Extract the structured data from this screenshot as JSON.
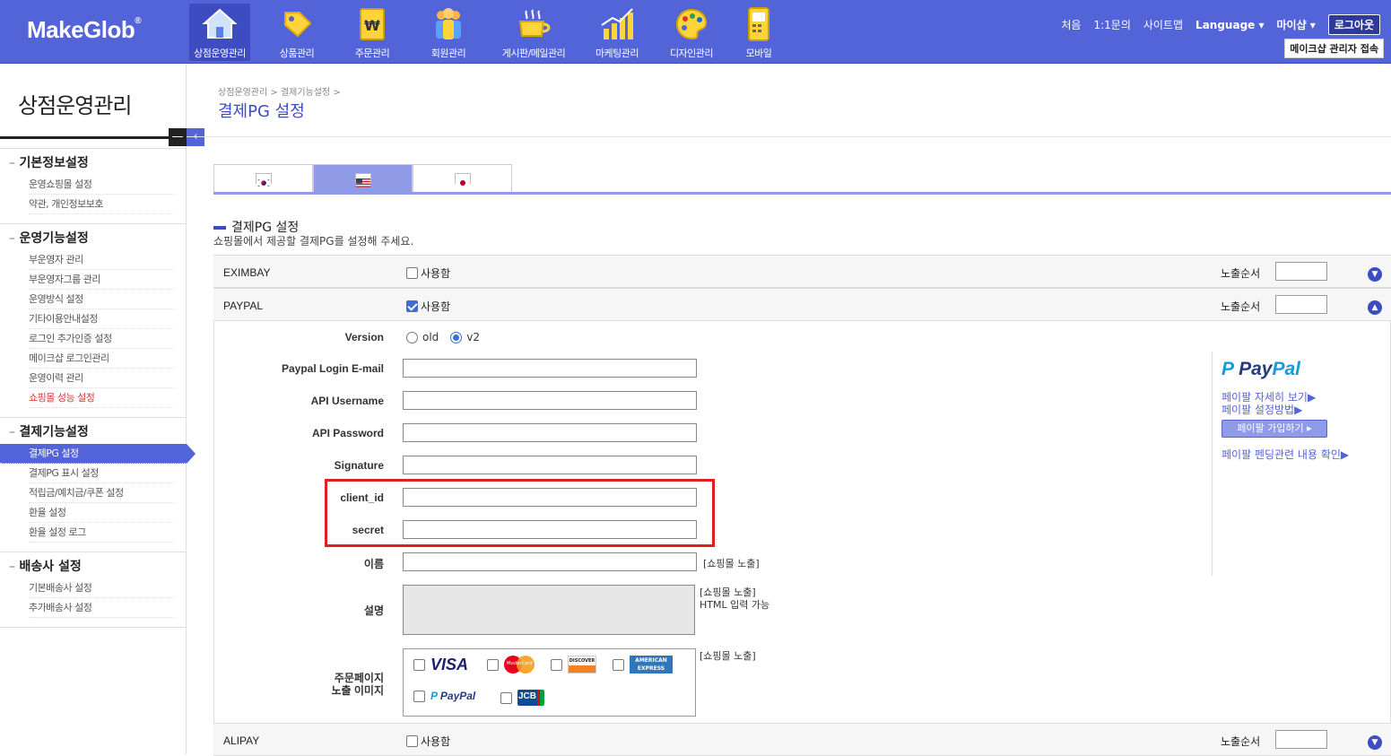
{
  "header": {
    "logo": "MakeGlob",
    "logo_mark": "®",
    "nav": [
      {
        "label": "상점운영관리",
        "icon": "home-icon"
      },
      {
        "label": "상품관리",
        "icon": "tag-icon"
      },
      {
        "label": "주문관리",
        "icon": "won-order-icon"
      },
      {
        "label": "회원관리",
        "icon": "members-icon"
      },
      {
        "label": "게시판/메일관리",
        "icon": "coffee-cup-icon"
      },
      {
        "label": "마케팅관리",
        "icon": "bar-chart-icon"
      },
      {
        "label": "디자인관리",
        "icon": "palette-icon"
      },
      {
        "label": "모바일",
        "icon": "mobile-icon"
      }
    ],
    "links": [
      "처음",
      "1:1문의",
      "사이트맵",
      "Language ▾",
      "마이샵 ▾"
    ],
    "logout": "로그아웃",
    "admin": "메이크샵 관리자 접속"
  },
  "sidebar": {
    "title": "상점운영관리",
    "groups": [
      {
        "header": "기본정보설정",
        "items": [
          "운영쇼핑몰 설정",
          "약관, 개인정보보호"
        ]
      },
      {
        "header": "운영기능설정",
        "items": [
          "부운영자 관리",
          "부운영자그룹 관리",
          "운영방식 설정",
          "기타이용안내설정",
          "로그인 추가인증 설정",
          "메이크샵 로그인관리",
          "운영이력 관리",
          "쇼핑몰 성능 설정"
        ]
      },
      {
        "header": "결제기능설정",
        "items": [
          "결제PG 설정",
          "결제PG 표시 설정",
          "적립금/예치금/쿠폰 설정",
          "환율 설정",
          "환율 설정 로그"
        ]
      },
      {
        "header": "배송사 설정",
        "items": [
          "기본배송사 설정",
          "추가배송사 설정"
        ]
      }
    ]
  },
  "main": {
    "breadcrumb": "상점운영관리 > 결제기능설정 >",
    "title": "결제PG 설정",
    "tabs": [
      "korea-flag-icon",
      "usa-flag-icon",
      "japan-flag-icon"
    ],
    "section_title": "결제PG 설정",
    "section_desc": "쇼핑몰에서 제공할 결제PG를 설정해 주세요.",
    "use_label": "사용함",
    "order_label": "노출순서",
    "pg_rows": [
      {
        "name": "EXIMBAY",
        "checked": false
      },
      {
        "name": "PAYPAL",
        "checked": true
      },
      {
        "name": "ALIPAY",
        "checked": false
      }
    ],
    "paypal": {
      "version_label": "Version",
      "version_options": [
        "old",
        "v2"
      ],
      "version_selected": "v2",
      "fields": [
        "Paypal Login E-mail",
        "API Username",
        "API Password",
        "Signature",
        "client_id",
        "secret",
        "이름"
      ],
      "name_note": "[쇼핑몰 노출]",
      "desc_label": "설명",
      "desc_note1": "[쇼핑몰 노출]",
      "desc_note2": "HTML 입력 가능",
      "img_label1": "주문페이지",
      "img_label2": "노출 이미지",
      "img_note": "[쇼핑몰 노출]",
      "cards": [
        "VISA",
        "MasterCard",
        "DISCOVER",
        "AMERICAN EXPRESS",
        "PayPal",
        "JCB"
      ]
    },
    "paypal_panel": {
      "logo_a": "Pay",
      "logo_b": "Pal",
      "link1": "페이팔 자세히 보기▶",
      "link2": "페이팔 설정방법▶",
      "button": "페이팔 가입하기 ▸",
      "link3": "페이팔 펜딩관련 내용 확인▶"
    }
  }
}
